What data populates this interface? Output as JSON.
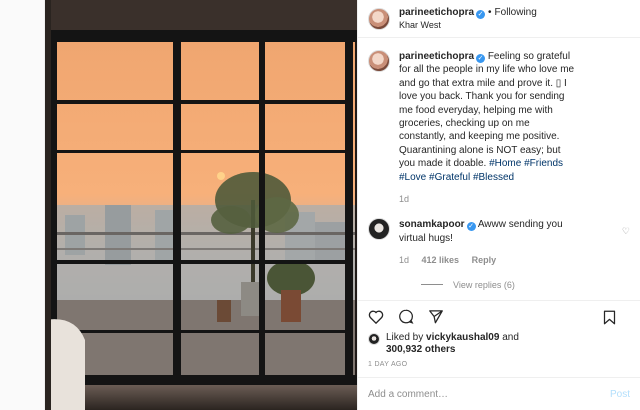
{
  "header": {
    "username": "parineetichopra",
    "separator": "•",
    "follow_state": "Following",
    "location": "Khar West"
  },
  "caption": {
    "username": "parineetichopra",
    "text": "Feeling so grateful for all the people in my life who love me and go that extra mile and prove it. ▯ I love you back. Thank you for sending me food everyday, helping me with groceries, checking up on me constantly, and keeping me positive. Quarantining alone is NOT easy; but you made it doable.",
    "hashtags": [
      "#Home",
      "#Friends",
      "#Love",
      "#Grateful",
      "#Blessed"
    ],
    "age": "1d"
  },
  "comment": {
    "username": "sonamkapoor",
    "text": "Awww sending you virtual hugs!",
    "age": "1d",
    "likes": "412 likes",
    "reply_label": "Reply",
    "view_replies": "View replies (6)"
  },
  "likes": {
    "liked_by": "Liked by",
    "user": "vickykaushal09",
    "and": "and",
    "others": "300,932 others"
  },
  "timestamp": "1 DAY AGO",
  "add_comment": {
    "placeholder": "Add a comment…",
    "post_label": "Post"
  },
  "icons": {
    "like": "heart-icon",
    "comment": "comment-icon",
    "share": "share-icon",
    "save": "bookmark-icon",
    "verified": "verified-badge-icon"
  },
  "colors": {
    "link": "#003569",
    "verified": "#3897f0",
    "muted": "#8e8e8e",
    "post_disabled": "#b2dffc"
  }
}
